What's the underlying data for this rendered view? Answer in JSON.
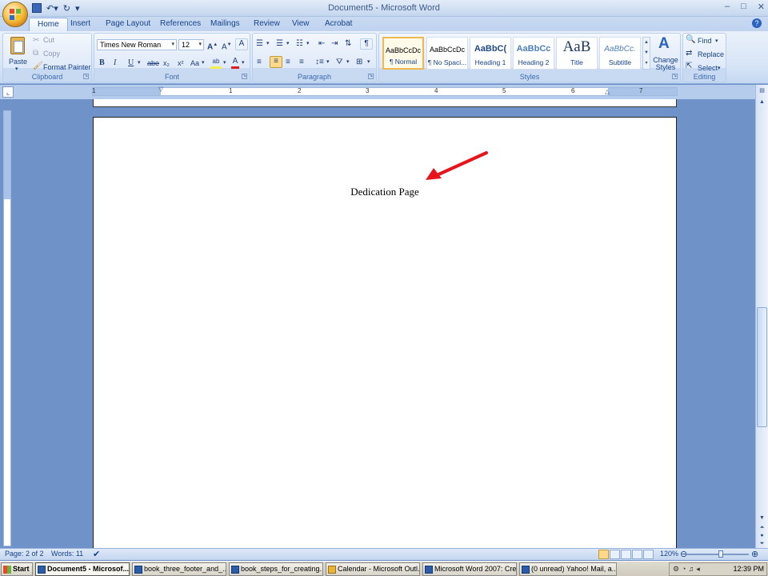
{
  "window": {
    "title": "Document5 - Microsoft Word"
  },
  "tabs": [
    {
      "label": "Home"
    },
    {
      "label": "Insert"
    },
    {
      "label": "Page Layout"
    },
    {
      "label": "References"
    },
    {
      "label": "Mailings"
    },
    {
      "label": "Review"
    },
    {
      "label": "View"
    },
    {
      "label": "Acrobat"
    }
  ],
  "ribbon": {
    "clipboard": {
      "label": "Clipboard",
      "paste": "Paste",
      "cut": "Cut",
      "copy": "Copy",
      "format_painter": "Format Painter"
    },
    "font": {
      "label": "Font",
      "font_name": "Times New Roman",
      "font_size": "12",
      "bold": "B",
      "italic": "I",
      "underline": "U",
      "strikethrough": "abe",
      "subscript": "x₂",
      "superscript": "x²",
      "change_case": "Aa"
    },
    "paragraph": {
      "label": "Paragraph"
    },
    "styles": {
      "label": "Styles",
      "items": [
        {
          "sample": "AaBbCcDc",
          "name": "¶ Normal"
        },
        {
          "sample": "AaBbCcDc",
          "name": "¶ No Spaci..."
        },
        {
          "sample": "AaBbC(",
          "name": "Heading 1"
        },
        {
          "sample": "AaBbCc",
          "name": "Heading 2"
        },
        {
          "sample": "AaB",
          "name": "Title"
        },
        {
          "sample": "AaBbCc.",
          "name": "Subtitle"
        }
      ],
      "change_styles": "Change Styles"
    },
    "editing": {
      "label": "Editing",
      "find": "Find",
      "replace": "Replace",
      "select": "Select"
    }
  },
  "ruler": {
    "numbers": [
      "1",
      "1",
      "2",
      "3",
      "4",
      "5",
      "6",
      "7"
    ]
  },
  "document": {
    "text": "Dedication Page",
    "annotation_color": "#e8141b"
  },
  "status": {
    "page": "Page: 2 of 2",
    "words": "Words: 11",
    "zoom": "120%"
  },
  "taskbar": {
    "start": "Start",
    "tasks": [
      {
        "label": "Document5 - Microsof...",
        "active": true
      },
      {
        "label": "book_three_footer_and_..."
      },
      {
        "label": "book_steps_for_creating..."
      },
      {
        "label": "Calendar - Microsoft Outl..."
      },
      {
        "label": "Microsoft Word 2007: Cre..."
      },
      {
        "label": "(0 unread) Yahoo! Mail, a..."
      }
    ],
    "clock": "12:39 PM"
  }
}
